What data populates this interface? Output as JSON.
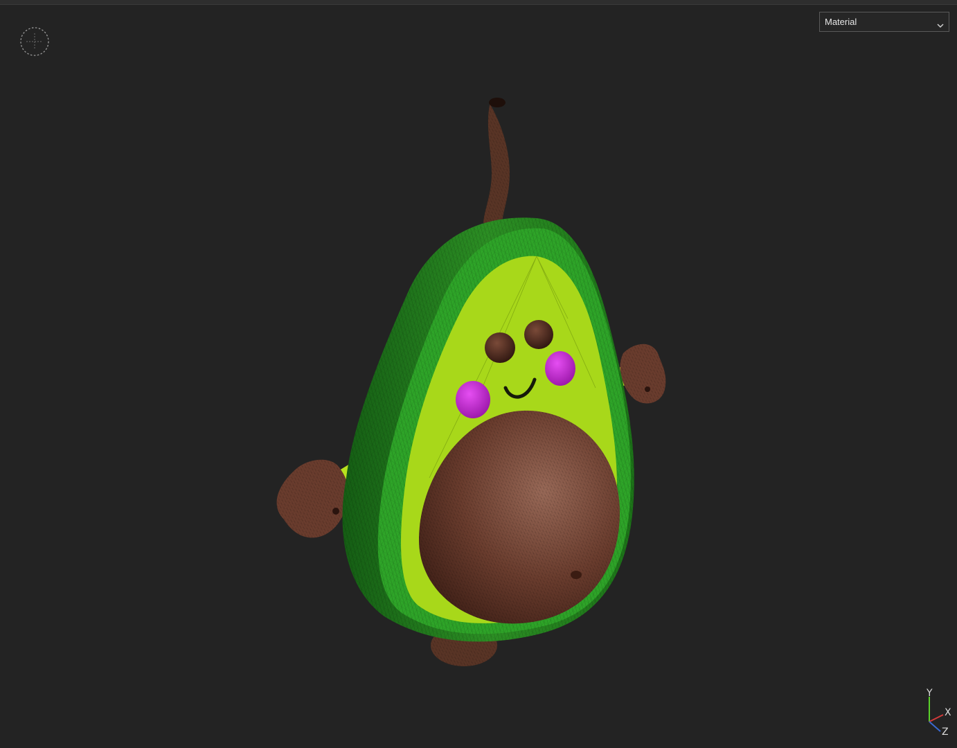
{
  "viewport": {
    "background": "#232323",
    "shading_mode": {
      "selected": "Material"
    },
    "navigation_gizmo": {
      "icon": "orbit-gizmo-icon"
    },
    "model": {
      "subject": "avatar-avocado",
      "colors": {
        "skin_dark": "#1f7a1c",
        "skin_light": "#39a830",
        "flesh": "#a8d81a",
        "pit": "#6b3d2e",
        "stem": "#5a3526",
        "cheeks": "#c02ccf"
      }
    },
    "axis_triad": {
      "y": "Y",
      "x": "X",
      "z": "Z"
    }
  }
}
